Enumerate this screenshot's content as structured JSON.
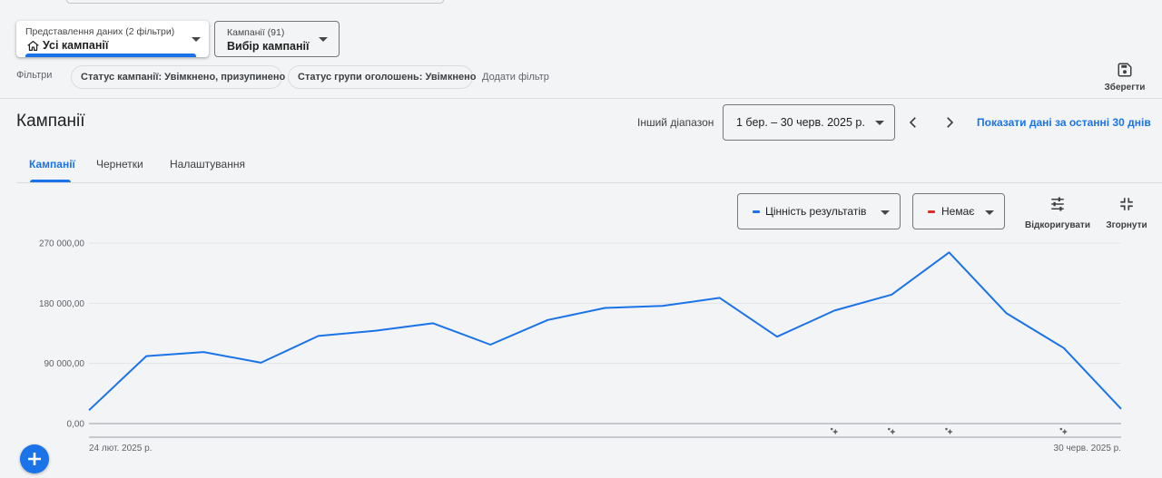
{
  "view_selector": {
    "label": "Представлення даних (2 фільтри)",
    "value": "Усі кампанії"
  },
  "campaign_selector": {
    "label": "Кампанії (91)",
    "value": "Вибір кампанії"
  },
  "filters": {
    "label": "Фільтри",
    "chips": [
      "Статус кампанії: Увімкнено, призупинено",
      "Статус групи оголошень: Увімкнено"
    ],
    "add_filter": "Додати фільтр",
    "save": "Зберегти"
  },
  "header": {
    "title": "Кампанії",
    "range_label": "Інший діапазон",
    "range_value": "1 бер. – 30 черв. 2025 р.",
    "last_30": "Показати дані за останні 30 днів"
  },
  "tabs": [
    "Кампанії",
    "Чернетки",
    "Налаштування"
  ],
  "metrics": {
    "primary": "Цінність результатів",
    "secondary": "Немає",
    "adjust": "Відкоригувати",
    "collapse": "Згорнути"
  },
  "colors": {
    "accent": "#1a73e8",
    "primary_metric": "#1a73e8",
    "secondary_metric": "#d93025"
  },
  "chart_data": {
    "type": "line",
    "ylim": [
      0,
      270000
    ],
    "yticks": [
      "0,00",
      "90 000,00",
      "180 000,00",
      "270 000,00"
    ],
    "x_start_label": "24 лют. 2025 р.",
    "x_end_label": "30 черв. 2025 р.",
    "grid": true,
    "series": [
      {
        "name": "Цінність результатів",
        "values": [
          20000,
          101000,
          107000,
          91000,
          131000,
          139000,
          150000,
          118000,
          155000,
          173000,
          176000,
          188000,
          130000,
          169000,
          193000,
          256000,
          165000,
          113000,
          22000
        ]
      }
    ],
    "annotation_icon": "sparkle-icon",
    "annotation_points": [
      13,
      14,
      15,
      17
    ]
  }
}
